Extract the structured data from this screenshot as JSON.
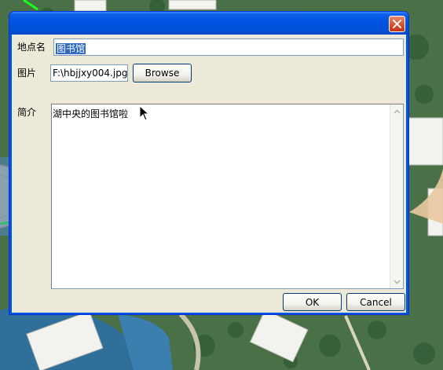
{
  "dialog": {
    "title": "",
    "close_icon": "close-icon",
    "name_label": "地点名",
    "name_value": "图书馆",
    "picture_label": "图片",
    "picture_value": "F:\\hbjjxy004.jpg",
    "browse_label": "Browse",
    "desc_label": "简介",
    "desc_value": "湖中央的图书馆啦",
    "ok_label": "OK",
    "cancel_label": "Cancel"
  },
  "colors": {
    "titlebar": "#0054e3",
    "client": "#ece9d8",
    "selection": "#316ac5",
    "close_button": "#d9502b",
    "map_water": "#2f6f9a",
    "map_trees": "#3e6d3e"
  }
}
